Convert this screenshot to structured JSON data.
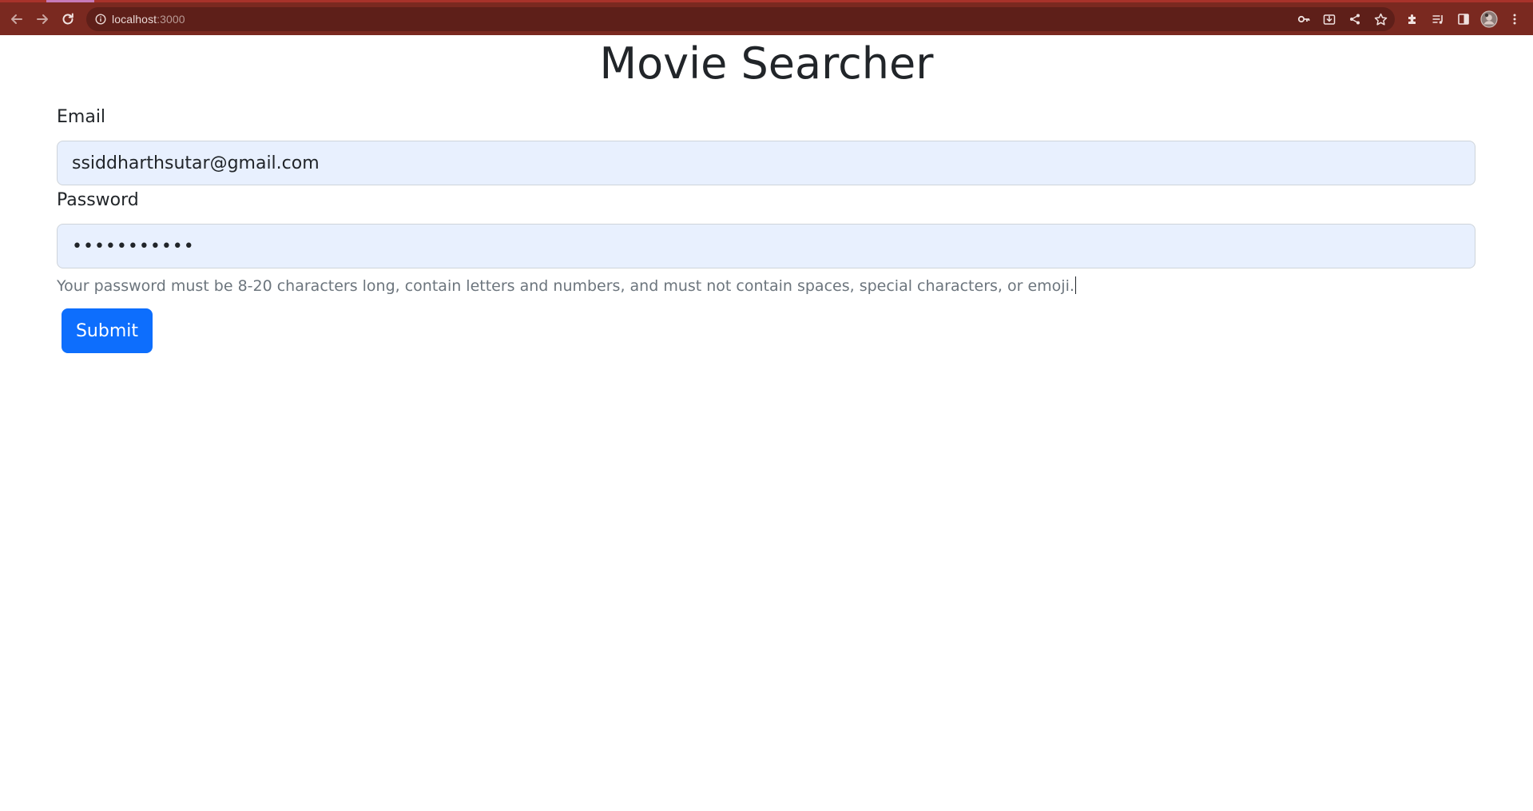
{
  "browser": {
    "url_host": "localhost",
    "url_port": ":3000",
    "chrome_color": "#7a2920",
    "icons": [
      "back-arrow-icon",
      "forward-arrow-icon",
      "reload-icon",
      "info-icon",
      "key-icon",
      "install-app-icon",
      "share-icon",
      "bookmark-star-icon",
      "extensions-icon",
      "reading-list-icon",
      "side-panel-icon",
      "profile-avatar",
      "menu-kebab-icon"
    ]
  },
  "page": {
    "title": "Movie Searcher"
  },
  "form": {
    "email_label": "Email",
    "email_value": "ssiddharthsutar@gmail.com",
    "password_label": "Password",
    "password_value": "•••••••••••",
    "password_help": "Your password must be 8-20 characters long, contain letters and numbers, and must not contain spaces, special characters, or emoji.",
    "submit_label": "Submit",
    "autofill_bg": "#e8f0fe",
    "primary_color": "#0d6efd"
  }
}
